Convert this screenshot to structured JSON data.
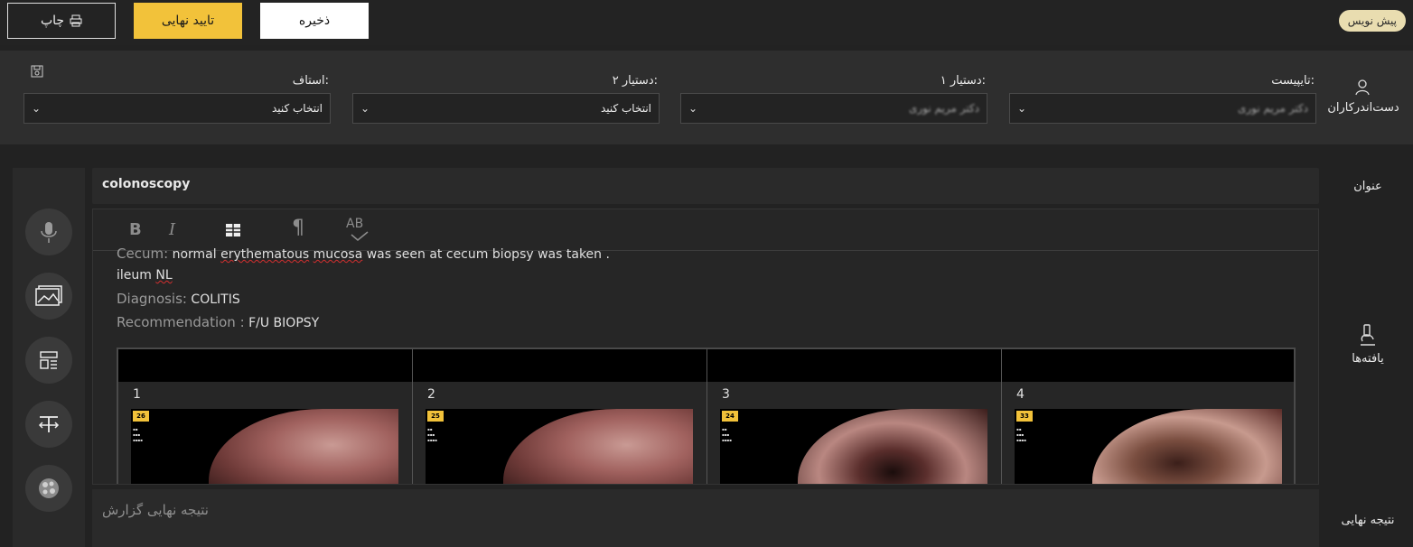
{
  "toolbar": {
    "print_label": "چاپ",
    "approve_label": "تایید نهایی",
    "save_label": "ذخیره",
    "draft_badge": "پیش نویس"
  },
  "staff": {
    "section_label": "دست‌اندرکاران",
    "fields": [
      {
        "label": "تایپیست:",
        "value": "دکتر مریم نوری",
        "blurred": true
      },
      {
        "label": "دستیار ۱:",
        "value": "دکتر مریم نوری",
        "blurred": true
      },
      {
        "label": "دستیار ۲:",
        "value": "انتخاب کنید",
        "blurred": false
      },
      {
        "label": "استاف:",
        "value": "انتخاب کنید",
        "blurred": false
      }
    ]
  },
  "labels": {
    "title": "عنوان",
    "findings": "یافته‌ها",
    "final_result": "نتیجه نهایی"
  },
  "report": {
    "title": "colonoscopy",
    "toolbar": {
      "bold": "B",
      "italic": "I",
      "paragraph": "¶",
      "spell": "AB"
    },
    "cecum_label": "Cecum:",
    "cecum_text_a": "normal",
    "cecum_text_b": "erythematous",
    "cecum_text_c": "mucosa",
    "cecum_text_d": "was seen at cecum biopsy was taken .",
    "ileum_a": "ileum",
    "ileum_b": "NL",
    "diagnosis_label": "Diagnosis:",
    "diagnosis_value": "COLITIS",
    "recommendation_label": "Recommendation :",
    "recommendation_value": "F/U BIOPSY",
    "images": [
      {
        "num": "1",
        "tag": "26"
      },
      {
        "num": "2",
        "tag": "25"
      },
      {
        "num": "3",
        "tag": "24"
      },
      {
        "num": "4",
        "tag": "33"
      }
    ],
    "final_result_placeholder": "نتیجه نهایی گزارش"
  },
  "colors": {
    "accent": "#f2c23a",
    "background": "#222222",
    "panel": "#2e2e2e"
  }
}
